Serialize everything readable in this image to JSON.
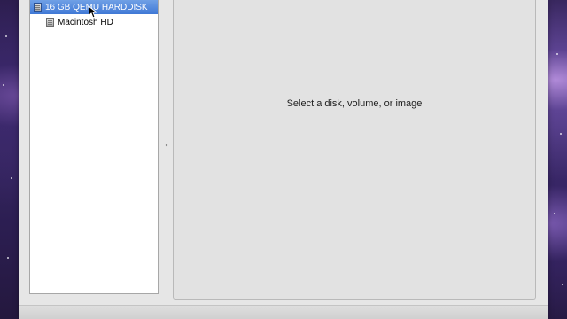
{
  "sidebar": {
    "items": [
      {
        "label": "16 GB QEMU HARDDISK",
        "icon": "hard-disk-icon",
        "selected": true,
        "indent": 0
      },
      {
        "label": "Macintosh HD",
        "icon": "volume-icon",
        "selected": false,
        "indent": 1
      }
    ]
  },
  "detail": {
    "message": "Select a disk, volume, or image"
  },
  "colors": {
    "selection": "#3f78d6",
    "window_bg": "#e6e6e6",
    "sidebar_bg": "#ffffff"
  }
}
